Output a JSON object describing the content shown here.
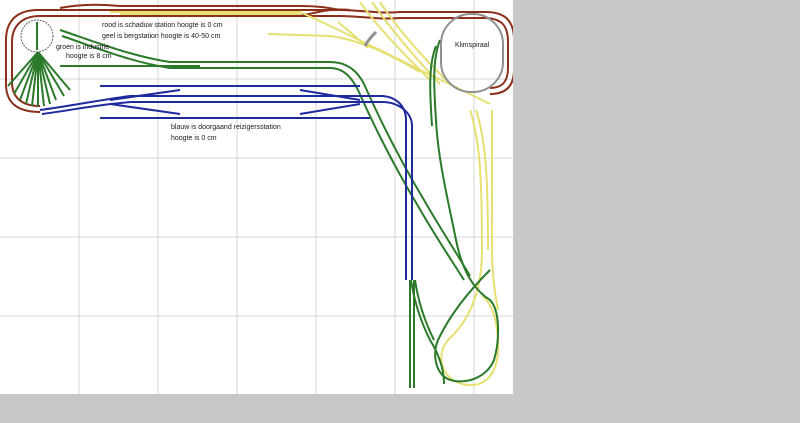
{
  "labels": {
    "rood": "rood is schaduw station hoogte is 0 cm",
    "geel": "geel is bergstation hoogte is 40-50 cm",
    "groen_1": "groen is industrie",
    "groen_2": "hoogte is 8 cm",
    "blauw_1": "blauw is doorgaand reizigersstation",
    "blauw_2": "hoogte is 0 cm",
    "klimspiraal": "Klimspiraal"
  },
  "track_colors": {
    "red": "#8b2e1a",
    "yellow": "#e6e070",
    "green": "#2a7a2a",
    "blue": "#1f2a9c",
    "gray": "#909090",
    "grid": "#d0d0d0",
    "background": "#c8c8c8",
    "canvas": "#ffffff"
  }
}
